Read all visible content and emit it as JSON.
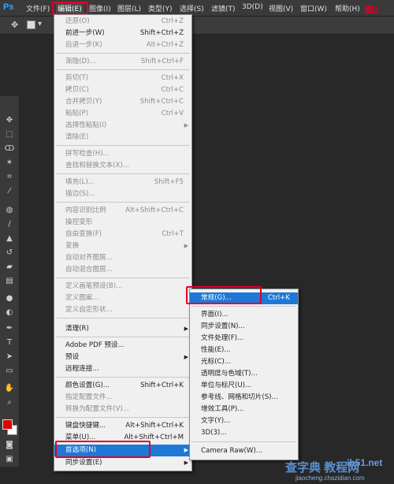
{
  "menubar": {
    "logo": "Ps",
    "items": [
      "文件(F)",
      "编辑(E)",
      "图像(I)",
      "图层(L)",
      "类型(Y)",
      "选择(S)",
      "滤镜(T)",
      "3D(D)",
      "视图(V)",
      "窗口(W)",
      "帮助(H)"
    ]
  },
  "edit_menu": {
    "items": [
      {
        "label": "还原(O)",
        "shortcut": "Ctrl+Z",
        "disabled": true
      },
      {
        "label": "前进一步(W)",
        "shortcut": "Shift+Ctrl+Z",
        "disabled": false
      },
      {
        "label": "后退一步(K)",
        "shortcut": "Alt+Ctrl+Z",
        "disabled": true
      },
      {
        "label": "渐隐(D)...",
        "shortcut": "Shift+Ctrl+F",
        "disabled": true
      },
      {
        "label": "剪切(T)",
        "shortcut": "Ctrl+X",
        "disabled": true
      },
      {
        "label": "拷贝(C)",
        "shortcut": "Ctrl+C",
        "disabled": true
      },
      {
        "label": "合并拷贝(Y)",
        "shortcut": "Shift+Ctrl+C",
        "disabled": true
      },
      {
        "label": "粘贴(P)",
        "shortcut": "Ctrl+V",
        "disabled": true
      },
      {
        "label": "选择性粘贴(I)",
        "shortcut": "",
        "disabled": true
      },
      {
        "label": "清除(E)",
        "shortcut": "",
        "disabled": true
      },
      {
        "label": "拼写检查(H)...",
        "shortcut": "",
        "disabled": true
      },
      {
        "label": "查找和替换文本(X)...",
        "shortcut": "",
        "disabled": true
      },
      {
        "label": "填充(L)...",
        "shortcut": "Shift+F5",
        "disabled": true
      },
      {
        "label": "描边(S)...",
        "shortcut": "",
        "disabled": true
      },
      {
        "label": "内容识别比例",
        "shortcut": "Alt+Shift+Ctrl+C",
        "disabled": true
      },
      {
        "label": "操控变形",
        "shortcut": "",
        "disabled": true
      },
      {
        "label": "自由变换(F)",
        "shortcut": "Ctrl+T",
        "disabled": true
      },
      {
        "label": "变换",
        "shortcut": "",
        "disabled": true
      },
      {
        "label": "自动对齐图层...",
        "shortcut": "",
        "disabled": true
      },
      {
        "label": "自动混合图层...",
        "shortcut": "",
        "disabled": true
      },
      {
        "label": "定义画笔预设(B)...",
        "shortcut": "",
        "disabled": true
      },
      {
        "label": "定义图案...",
        "shortcut": "",
        "disabled": true
      },
      {
        "label": "定义自定形状...",
        "shortcut": "",
        "disabled": true
      },
      {
        "label": "清理(R)",
        "shortcut": "",
        "disabled": false
      },
      {
        "label": "Adobe PDF 预设...",
        "shortcut": "",
        "disabled": false
      },
      {
        "label": "预设",
        "shortcut": "",
        "disabled": false
      },
      {
        "label": "远程连接...",
        "shortcut": "",
        "disabled": false
      },
      {
        "label": "颜色设置(G)...",
        "shortcut": "Shift+Ctrl+K",
        "disabled": false
      },
      {
        "label": "指定配置文件...",
        "shortcut": "",
        "disabled": true
      },
      {
        "label": "转换为配置文件(V)...",
        "shortcut": "",
        "disabled": true
      },
      {
        "label": "键盘快捷键...",
        "shortcut": "Alt+Shift+Ctrl+K",
        "disabled": false
      },
      {
        "label": "菜单(U)...",
        "shortcut": "Alt+Shift+Ctrl+M",
        "disabled": false
      },
      {
        "label": "首选项(N)",
        "shortcut": "",
        "disabled": false
      },
      {
        "label": "同步设置(E)",
        "shortcut": "",
        "disabled": false
      }
    ]
  },
  "prefs_menu": {
    "items": [
      {
        "label": "常规(G)...",
        "shortcut": "Ctrl+K"
      },
      {
        "label": "界面(I)...",
        "shortcut": ""
      },
      {
        "label": "同步设置(N)...",
        "shortcut": ""
      },
      {
        "label": "文件处理(F)...",
        "shortcut": ""
      },
      {
        "label": "性能(E)...",
        "shortcut": ""
      },
      {
        "label": "光标(C)...",
        "shortcut": ""
      },
      {
        "label": "透明度与色域(T)...",
        "shortcut": ""
      },
      {
        "label": "单位与标尺(U)...",
        "shortcut": ""
      },
      {
        "label": "参考线、网格和切片(S)...",
        "shortcut": ""
      },
      {
        "label": "增效工具(P)...",
        "shortcut": ""
      },
      {
        "label": "文字(Y)...",
        "shortcut": ""
      },
      {
        "label": "3D(3)...",
        "shortcut": ""
      },
      {
        "label": "Camera Raw(W)...",
        "shortcut": ""
      }
    ]
  },
  "watermarks": {
    "step": "图1",
    "site_cn": "查字典 教程网",
    "site_num": "ib51.net",
    "site_url": "jiaocheng.chazidian.com"
  },
  "colors": {
    "accent": "#1e78d6",
    "highlight": "#e0002a",
    "foreground_swatch": "#e00000",
    "background_swatch": "#ffffff"
  }
}
